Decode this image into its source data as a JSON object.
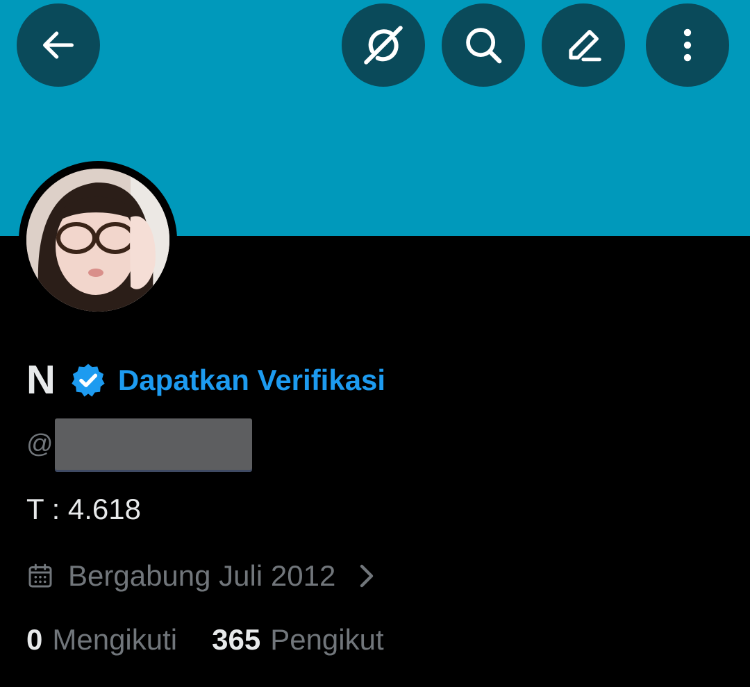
{
  "profile": {
    "display_name": "N",
    "verify_link": "Dapatkan Verifikasi",
    "handle_prefix": "@",
    "bio": "T : 4.618",
    "joined": "Bergabung Juli 2012",
    "following_count": "0",
    "following_label": "Mengikuti",
    "followers_count": "365",
    "followers_label": "Pengikut"
  },
  "header": {
    "icons": [
      "back-arrow-icon",
      "grok-icon",
      "search-icon",
      "edit-pencil-icon",
      "more-vertical-icon"
    ]
  },
  "colors": {
    "banner": "#0099bb",
    "button_bg": "#0a4a5a",
    "accent": "#1d9bf0",
    "background": "#000000",
    "primary_text": "#e7e9ea",
    "secondary_text": "#71767b"
  }
}
